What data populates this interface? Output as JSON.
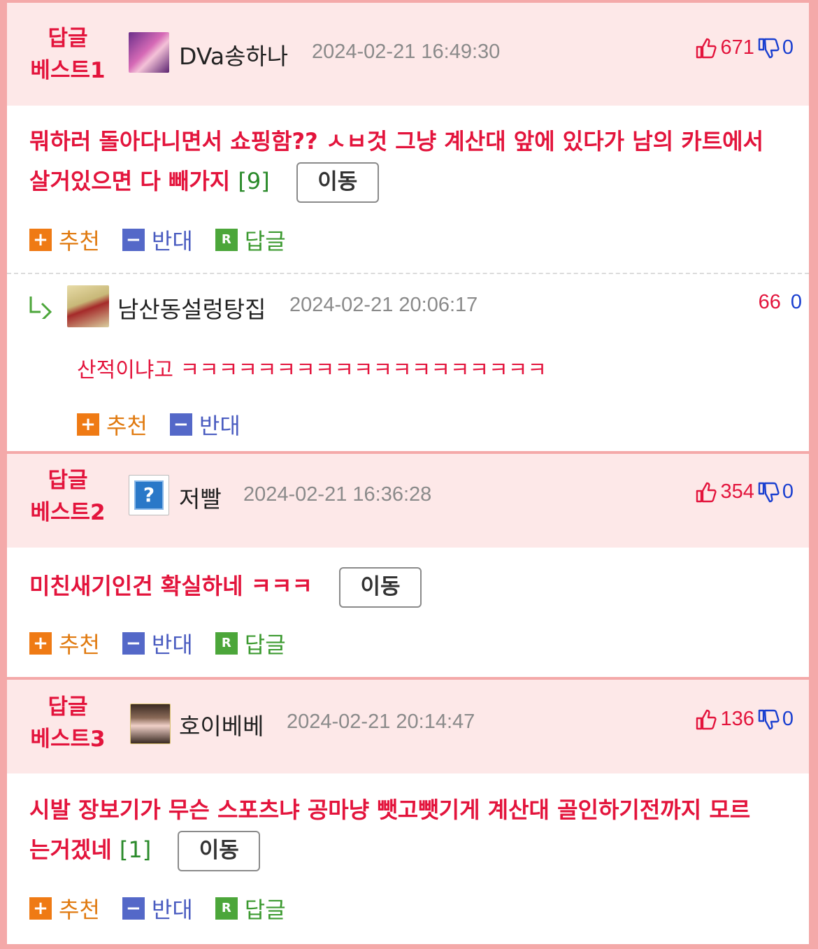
{
  "colors": {
    "accent_red": "#e3143c",
    "border_pink": "#f4a9a9",
    "head_bg": "#fde8e8",
    "recommend": "#ef7a14",
    "oppose": "#5468c8",
    "reply": "#4ca63a"
  },
  "actions": {
    "recommend": "추천",
    "oppose": "반대",
    "reply": "답글",
    "move": "이동"
  },
  "best1": {
    "label_top": "답글",
    "label_bottom": "베스트1",
    "nick": "DVa송하나",
    "date": "2024-02-21 16:49:30",
    "up": "671",
    "down": "0",
    "text_line1": "뭐하러 돌아다니면서 쇼핑함?? ㅅㅂ것 그냥 계산대 앞에 있다가 남의 카트에서",
    "text_line2": "살거있으면 다 빼가지",
    "reply_count": "[9]"
  },
  "reply1": {
    "nick": "남산동설렁탕집",
    "date": "2024-02-21 20:06:17",
    "up": "66",
    "down": "0",
    "text": "산적이냐고 ㅋㅋㅋㅋㅋㅋㅋㅋㅋㅋㅋㅋㅋㅋㅋㅋㅋㅋㅋ"
  },
  "best2": {
    "label_top": "답글",
    "label_bottom": "베스트2",
    "nick": "저빨",
    "date": "2024-02-21 16:36:28",
    "up": "354",
    "down": "0",
    "text_line1": "미친새기인건 확실하네 ㅋㅋㅋ"
  },
  "best3": {
    "label_top": "답글",
    "label_bottom": "베스트3",
    "nick": "호이베베",
    "date": "2024-02-21 20:14:47",
    "up": "136",
    "down": "0",
    "text_line1": "시발 장보기가 무슨 스포츠냐 공마냥 뺏고뺏기게 계산대 골인하기전까지 모르",
    "text_line2": "는거겠네",
    "reply_count": "[1]"
  }
}
